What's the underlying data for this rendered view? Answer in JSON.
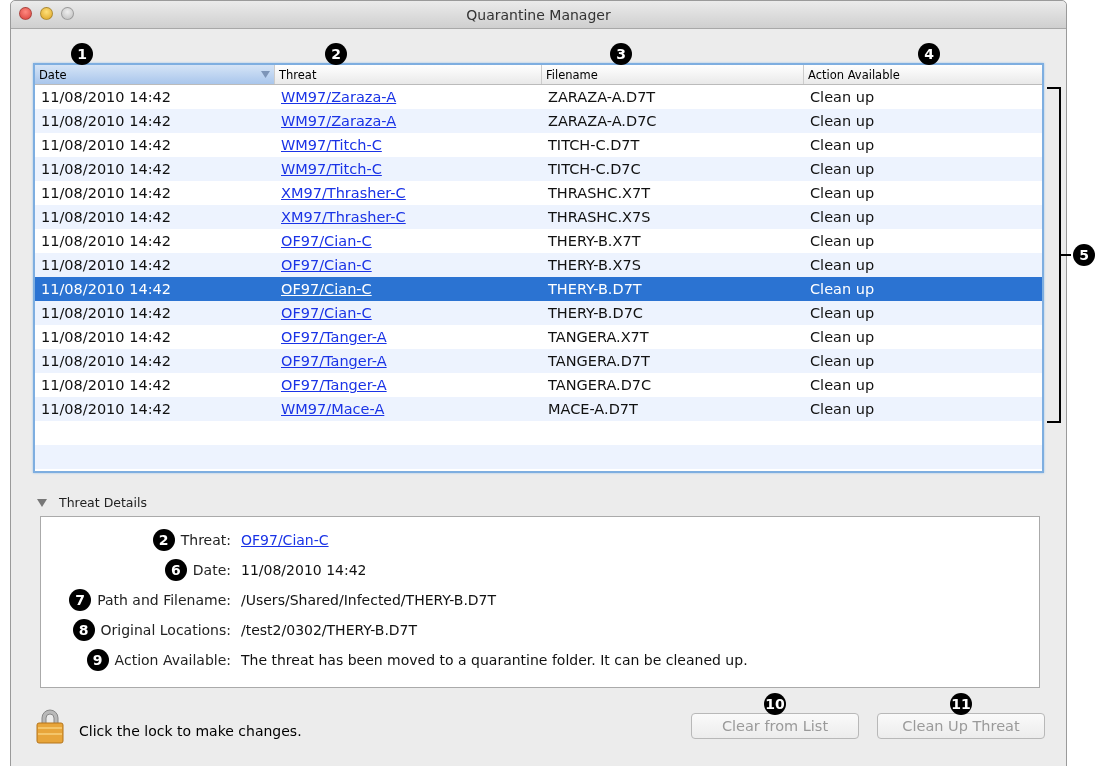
{
  "window": {
    "title": "Quarantine Manager"
  },
  "table": {
    "columns": [
      {
        "label": "Date",
        "selected": true,
        "callout": "1"
      },
      {
        "label": "Threat",
        "selected": false,
        "callout": "2"
      },
      {
        "label": "Filename",
        "selected": false,
        "callout": "3"
      },
      {
        "label": "Action Available",
        "selected": false,
        "callout": "4"
      }
    ],
    "rows_callout": "5",
    "rows": [
      {
        "date": "11/08/2010 14:42",
        "threat": "WM97/Zaraza-A",
        "filename": "ZARAZA-A.D7T",
        "action": "Clean up",
        "selected": false
      },
      {
        "date": "11/08/2010 14:42",
        "threat": "WM97/Zaraza-A",
        "filename": "ZARAZA-A.D7C",
        "action": "Clean up",
        "selected": false
      },
      {
        "date": "11/08/2010 14:42",
        "threat": "WM97/Titch-C",
        "filename": "TITCH-C.D7T",
        "action": "Clean up",
        "selected": false
      },
      {
        "date": "11/08/2010 14:42",
        "threat": "WM97/Titch-C",
        "filename": "TITCH-C.D7C",
        "action": "Clean up",
        "selected": false
      },
      {
        "date": "11/08/2010 14:42",
        "threat": "XM97/Thrasher-C",
        "filename": "THRASHC.X7T",
        "action": "Clean up",
        "selected": false
      },
      {
        "date": "11/08/2010 14:42",
        "threat": "XM97/Thrasher-C",
        "filename": "THRASHC.X7S",
        "action": "Clean up",
        "selected": false
      },
      {
        "date": "11/08/2010 14:42",
        "threat": "OF97/Cian-C",
        "filename": "THERY-B.X7T",
        "action": "Clean up",
        "selected": false
      },
      {
        "date": "11/08/2010 14:42",
        "threat": "OF97/Cian-C",
        "filename": "THERY-B.X7S",
        "action": "Clean up",
        "selected": false
      },
      {
        "date": "11/08/2010 14:42",
        "threat": "OF97/Cian-C",
        "filename": "THERY-B.D7T",
        "action": "Clean up",
        "selected": true
      },
      {
        "date": "11/08/2010 14:42",
        "threat": "OF97/Cian-C",
        "filename": "THERY-B.D7C",
        "action": "Clean up",
        "selected": false
      },
      {
        "date": "11/08/2010 14:42",
        "threat": "OF97/Tanger-A",
        "filename": "TANGERA.X7T",
        "action": "Clean up",
        "selected": false
      },
      {
        "date": "11/08/2010 14:42",
        "threat": "OF97/Tanger-A",
        "filename": "TANGERA.D7T",
        "action": "Clean up",
        "selected": false
      },
      {
        "date": "11/08/2010 14:42",
        "threat": "OF97/Tanger-A",
        "filename": "TANGERA.D7C",
        "action": "Clean up",
        "selected": false
      },
      {
        "date": "11/08/2010 14:42",
        "threat": "WM97/Mace-A",
        "filename": "MACE-A.D7T",
        "action": "Clean up",
        "selected": false
      }
    ]
  },
  "details": {
    "title": "Threat Details",
    "expanded": true,
    "fields": [
      {
        "label": "Threat:",
        "value": "OF97/Cian-C",
        "kind": "link",
        "callout": "2"
      },
      {
        "label": "Date:",
        "value": "11/08/2010 14:42",
        "kind": "text",
        "callout": "6"
      },
      {
        "label": "Path and Filename:",
        "value": "/Users/Shared/Infected/THERY-B.D7T",
        "kind": "text",
        "callout": "7"
      },
      {
        "label": "Original Locations:",
        "value": "/test2/0302/THERY-B.D7T",
        "kind": "text",
        "callout": "8"
      },
      {
        "label": "Action Available:",
        "value": "The threat has been moved to a quarantine folder. It can be cleaned up.",
        "kind": "text",
        "callout": "9"
      }
    ]
  },
  "lock_text": "Click the lock to make changes.",
  "buttons": [
    {
      "label": "Clear from List",
      "disabled": true,
      "callout": "10"
    },
    {
      "label": "Clean Up Threat",
      "disabled": true,
      "callout": "11"
    }
  ]
}
